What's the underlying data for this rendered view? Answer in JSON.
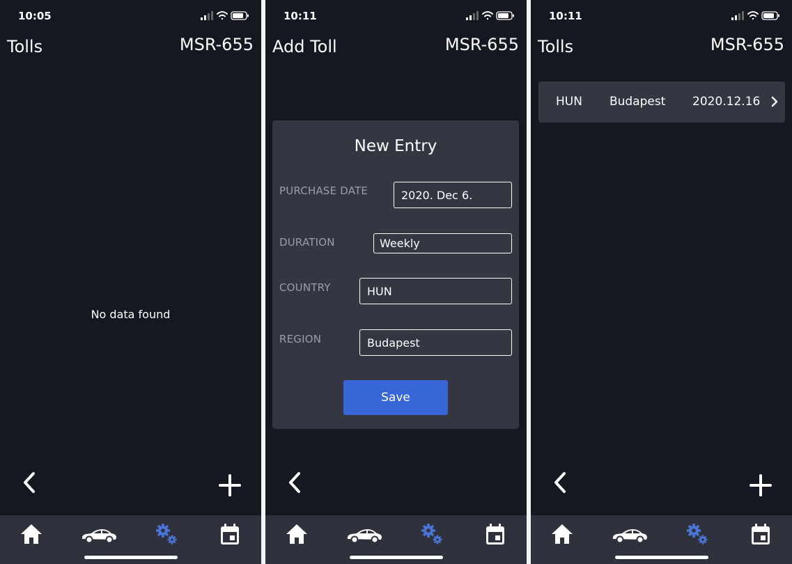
{
  "colors": {
    "background": "#161821",
    "card": "#343741",
    "tabbar": "#2f323d",
    "accent": "#3866d8",
    "settings_active": "#4a74d8",
    "label": "#9a9cab"
  },
  "icons": {
    "back": "chevron-left-icon",
    "add": "plus-icon",
    "home": "home-icon",
    "car": "car-icon",
    "settings": "gears-icon",
    "calendar": "calendar-icon",
    "chevron": "chevron-right-icon"
  },
  "screens": [
    {
      "time": "10:05",
      "title": "Tolls",
      "plate": "MSR-655",
      "empty_text": "No data found"
    },
    {
      "time": "10:11",
      "title": "Add Toll",
      "plate": "MSR-655",
      "form": {
        "title": "New Entry",
        "purchase_date": {
          "label": "PURCHASE DATE",
          "value": "2020. Dec 6."
        },
        "duration": {
          "label": "DURATION",
          "value": "Weekly"
        },
        "country": {
          "label": "COUNTRY",
          "value": "HUN"
        },
        "region": {
          "label": "REGION",
          "value": "Budapest"
        },
        "save_label": "Save"
      }
    },
    {
      "time": "10:11",
      "title": "Tolls",
      "plate": "MSR-655",
      "items": [
        {
          "country": "HUN",
          "region": "Budapest",
          "date": "2020.12.16"
        }
      ]
    }
  ]
}
